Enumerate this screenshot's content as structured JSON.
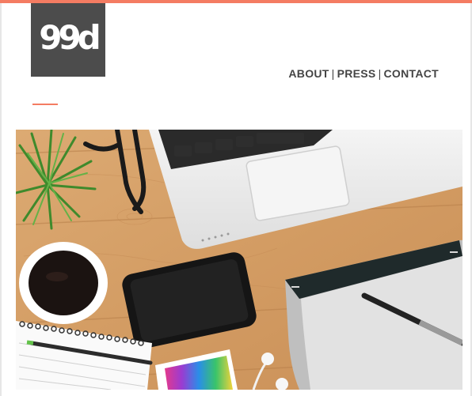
{
  "brand": {
    "logo_text": "99d",
    "accent_color": "#f47c62",
    "logo_bg": "#4c4c4c"
  },
  "nav": {
    "items": [
      {
        "label": "ABOUT"
      },
      {
        "label": "PRESS"
      },
      {
        "label": "CONTACT"
      }
    ],
    "separator": "|"
  },
  "hero": {
    "icon": "desk-workspace-photo",
    "alt": "Desk with laptop, coffee, phone and drawing tablet"
  }
}
